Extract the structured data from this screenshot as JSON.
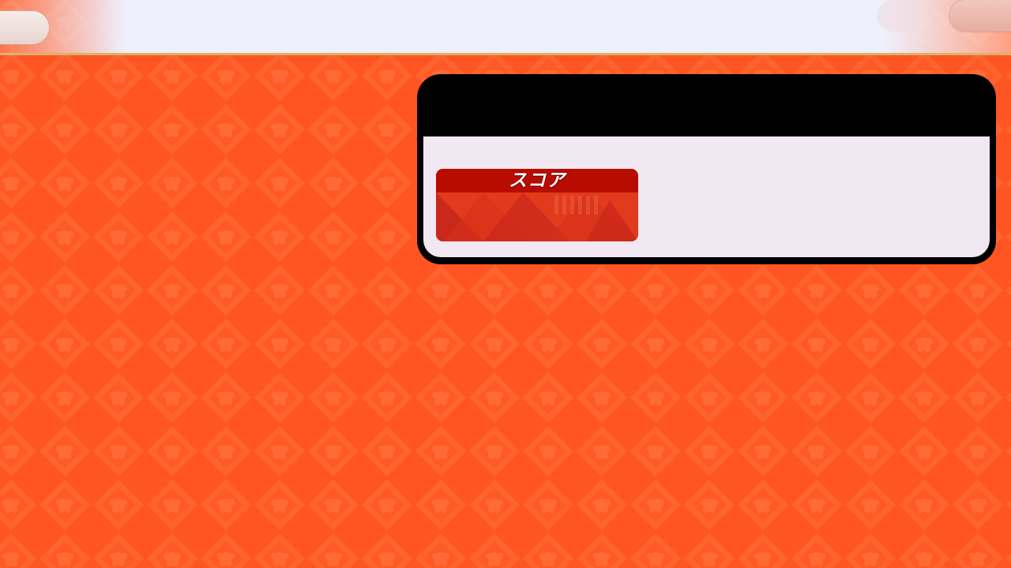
{
  "score_card": {
    "label": "スコア"
  },
  "colors": {
    "background": "#ff5a24",
    "pattern": "#ff6a35",
    "panel_border": "#000000",
    "panel_fill": "#f2e8f1",
    "score_header": "#b80c00",
    "score_body": "#e23a1c"
  }
}
